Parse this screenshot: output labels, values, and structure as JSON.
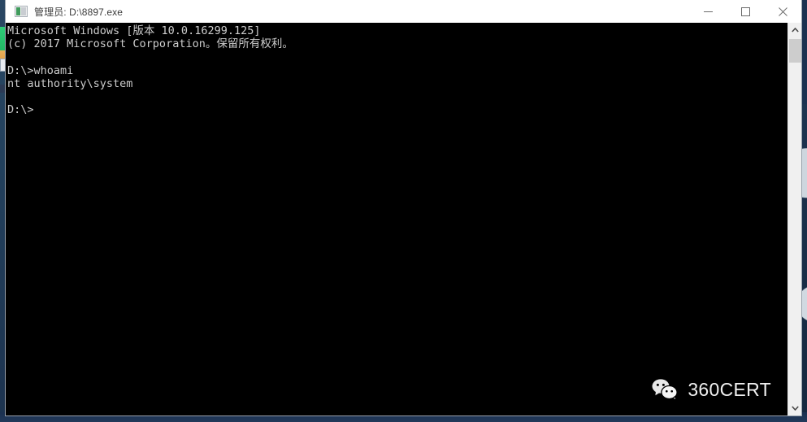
{
  "window": {
    "title": "管理员: D:\\8897.exe",
    "app_icon": "console-icon",
    "controls": {
      "minimize_label": "最小化",
      "maximize_label": "最大化",
      "close_label": "关闭"
    }
  },
  "console": {
    "text": "Microsoft Windows [版本 10.0.16299.125]\n(c) 2017 Microsoft Corporation。保留所有权利。\n\nD:\\>whoami\nnt authority\\system\n\nD:\\>",
    "lines": [
      "Microsoft Windows [版本 10.0.16299.125]",
      "(c) 2017 Microsoft Corporation。保留所有权利。",
      "",
      "D:\\>whoami",
      "nt authority\\system",
      "",
      "D:\\>"
    ],
    "command": "whoami",
    "command_output": "nt authority\\system",
    "prompt": "D:\\>",
    "background_color": "#000000",
    "foreground_color": "#cccccc"
  },
  "watermark": {
    "text": "360CERT",
    "icon": "wechat-bubbles-icon"
  },
  "scrollbar": {
    "up_arrow": "scroll-up-icon",
    "down_arrow": "scroll-down-icon",
    "thumb": "scrollbar-thumb"
  },
  "desktop": {
    "background_color": "#1d3450",
    "icons": [
      {
        "name": "desktop-icon-green",
        "color": "#2ecc78"
      },
      {
        "name": "desktop-icon-orange",
        "color": "#dd8f2a"
      },
      {
        "name": "desktop-icon-small",
        "color": "#e9edf2"
      }
    ]
  }
}
